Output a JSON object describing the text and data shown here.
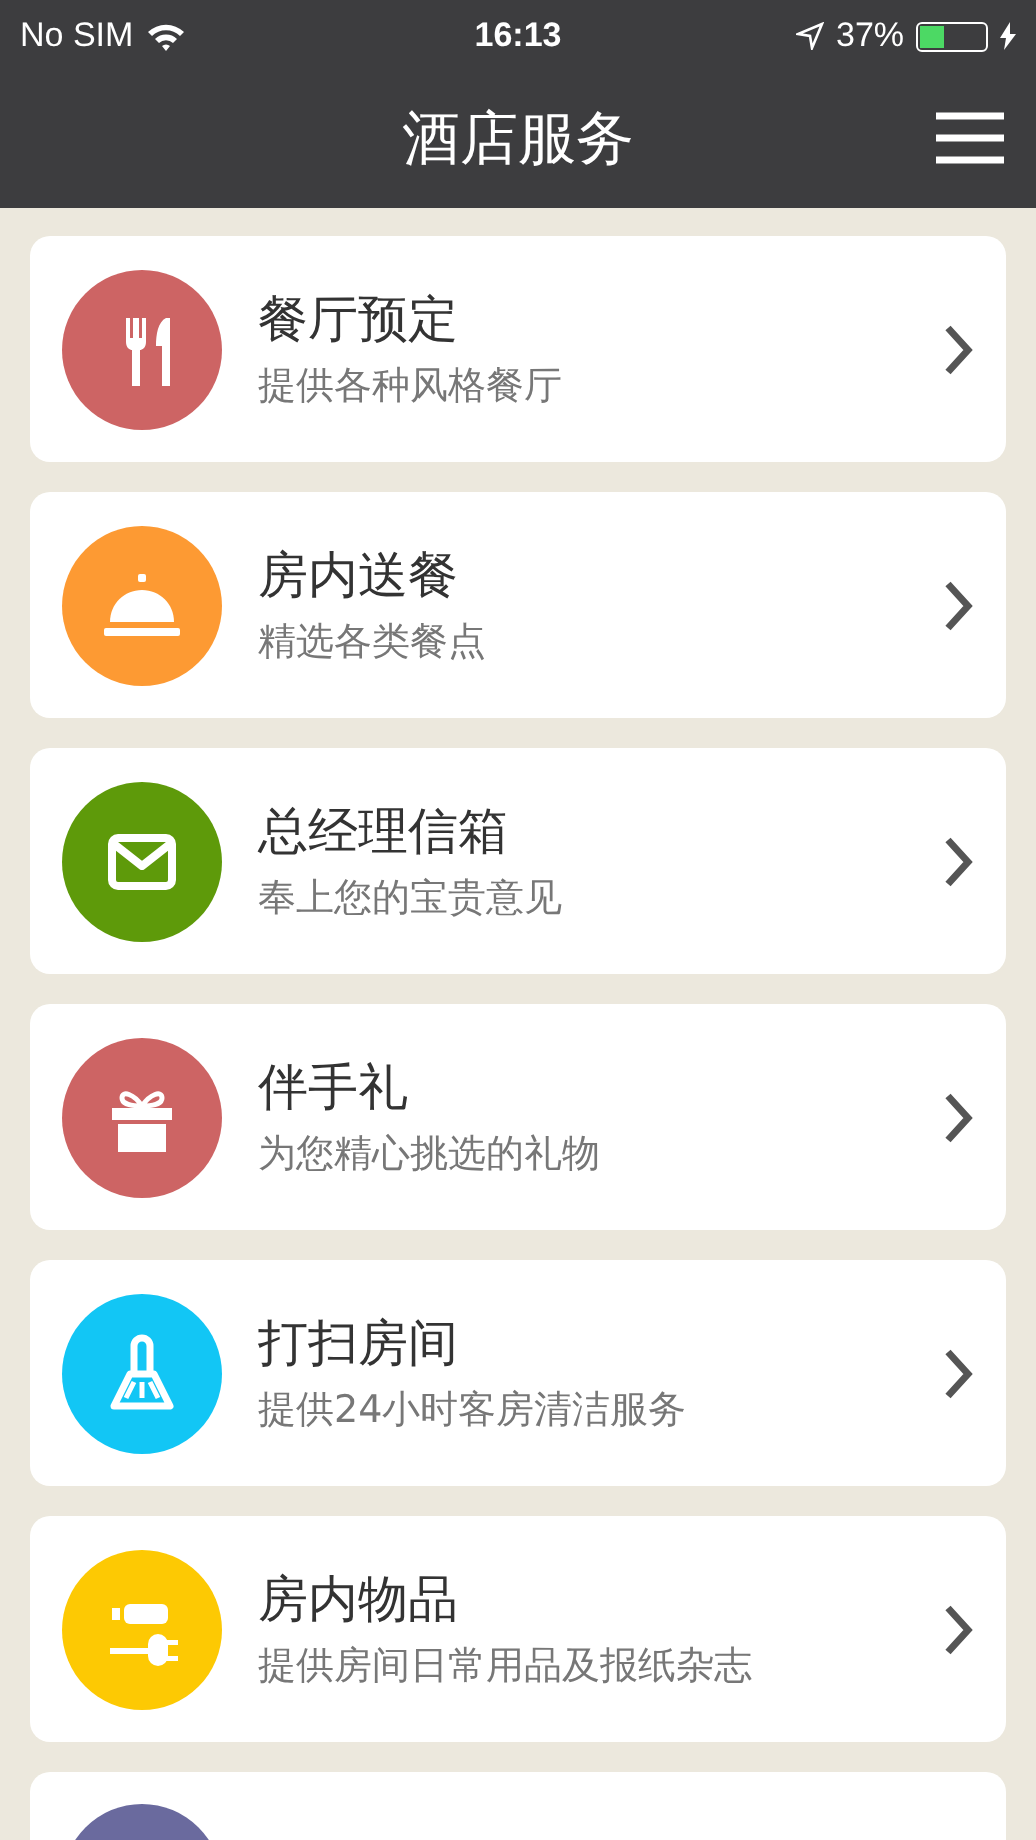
{
  "status_bar": {
    "carrier": "No SIM",
    "time": "16:13",
    "battery_text": "37%",
    "battery": {
      "level": 0.37,
      "charging": true
    }
  },
  "header": {
    "title": "酒店服务"
  },
  "services": [
    {
      "kind": "restaurant",
      "title": "餐厅预定",
      "subtitle": "提供各种风格餐厅",
      "color": "#cd6464"
    },
    {
      "kind": "room-dining",
      "title": "房内送餐",
      "subtitle": "精选各类餐点",
      "color": "#fd9a33"
    },
    {
      "kind": "mail",
      "title": "总经理信箱",
      "subtitle": "奉上您的宝贵意见",
      "color": "#5e9a0a"
    },
    {
      "kind": "gift",
      "title": "伴手礼",
      "subtitle": "为您精心挑选的礼物",
      "color": "#cd6464"
    },
    {
      "kind": "cleaning",
      "title": "打扫房间",
      "subtitle": "提供24小时客房清洁服务",
      "color": "#12c6f5"
    },
    {
      "kind": "supplies",
      "title": "房内物品",
      "subtitle": "提供房间日常用品及报纸杂志",
      "color": "#fdc903"
    },
    {
      "kind": "assistant",
      "color": "#6a6a9e"
    }
  ]
}
